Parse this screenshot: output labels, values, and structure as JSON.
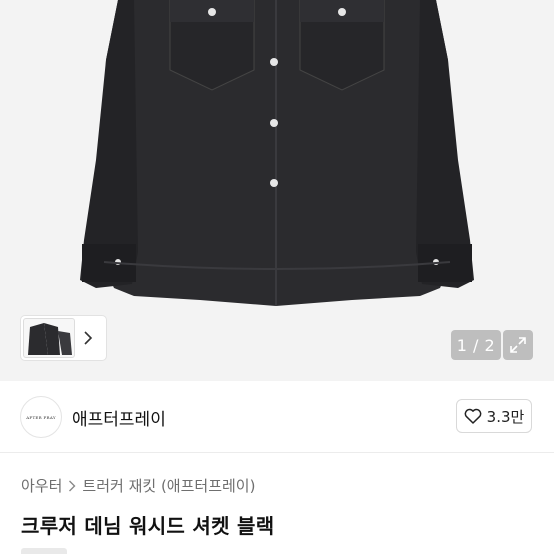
{
  "gallery": {
    "counter_text": "1 / 2",
    "icons": {
      "next": "chevron-right-icon",
      "expand": "expand-arrows-icon"
    }
  },
  "shop": {
    "name": "애프터프레이",
    "avatar_text": "AFTER PRAY",
    "like_count": "3.3만",
    "like_icon": "heart-outline-icon"
  },
  "breadcrumb": {
    "items": [
      "아우터",
      "트러커 재킷 (애프터프레이)"
    ]
  },
  "product": {
    "title": "크루저 데님 워시드 셔켓 블랙"
  },
  "colors": {
    "denim": "#2a2a2c",
    "overlay": "#b4b4b4"
  }
}
